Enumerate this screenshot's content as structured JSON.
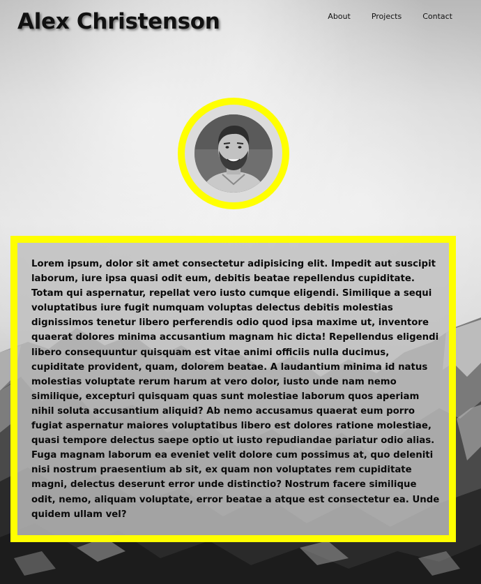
{
  "header": {
    "title": "Alex Christenson"
  },
  "nav": {
    "items": [
      {
        "label": "About"
      },
      {
        "label": "Projects"
      },
      {
        "label": "Contact"
      }
    ]
  },
  "profile": {
    "ring_color": "#ffff00"
  },
  "bio": {
    "text": "Lorem ipsum, dolor sit amet consectetur adipisicing elit. Impedit aut suscipit laborum, iure ipsa quasi odit eum, debitis beatae repellendus cupiditate. Totam qui aspernatur, repellat vero iusto cumque eligendi. Similique a sequi voluptatibus iure fugit numquam voluptas delectus debitis molestias dignissimos tenetur libero perferendis odio quod ipsa maxime ut, inventore quaerat dolores minima accusantium magnam hic dicta! Repellendus eligendi libero consequuntur quisquam est vitae animi officiis nulla ducimus, cupiditate provident, quam, dolorem beatae. A laudantium minima id natus molestias voluptate rerum harum at vero dolor, iusto unde nam nemo similique, excepturi quisquam quas sunt molestiae laborum quos aperiam nihil soluta accusantium aliquid? Ab nemo accusamus quaerat eum porro fugiat aspernatur maiores voluptatibus libero est dolores ratione molestiae, quasi tempore delectus saepe optio ut iusto repudiandae pariatur odio alias. Fuga magnam laborum ea eveniet velit dolore cum possimus at, quo deleniti nisi nostrum praesentium ab sit, ex quam non voluptates rem cupiditate magni, delectus deserunt error unde distinctio? Nostrum facere similique odit, nemo, aliquam voluptate, error beatae a atque est consectetur ea. Unde quidem ullam vel?"
  },
  "colors": {
    "accent": "#ffff00",
    "text": "#0a0a0a"
  }
}
